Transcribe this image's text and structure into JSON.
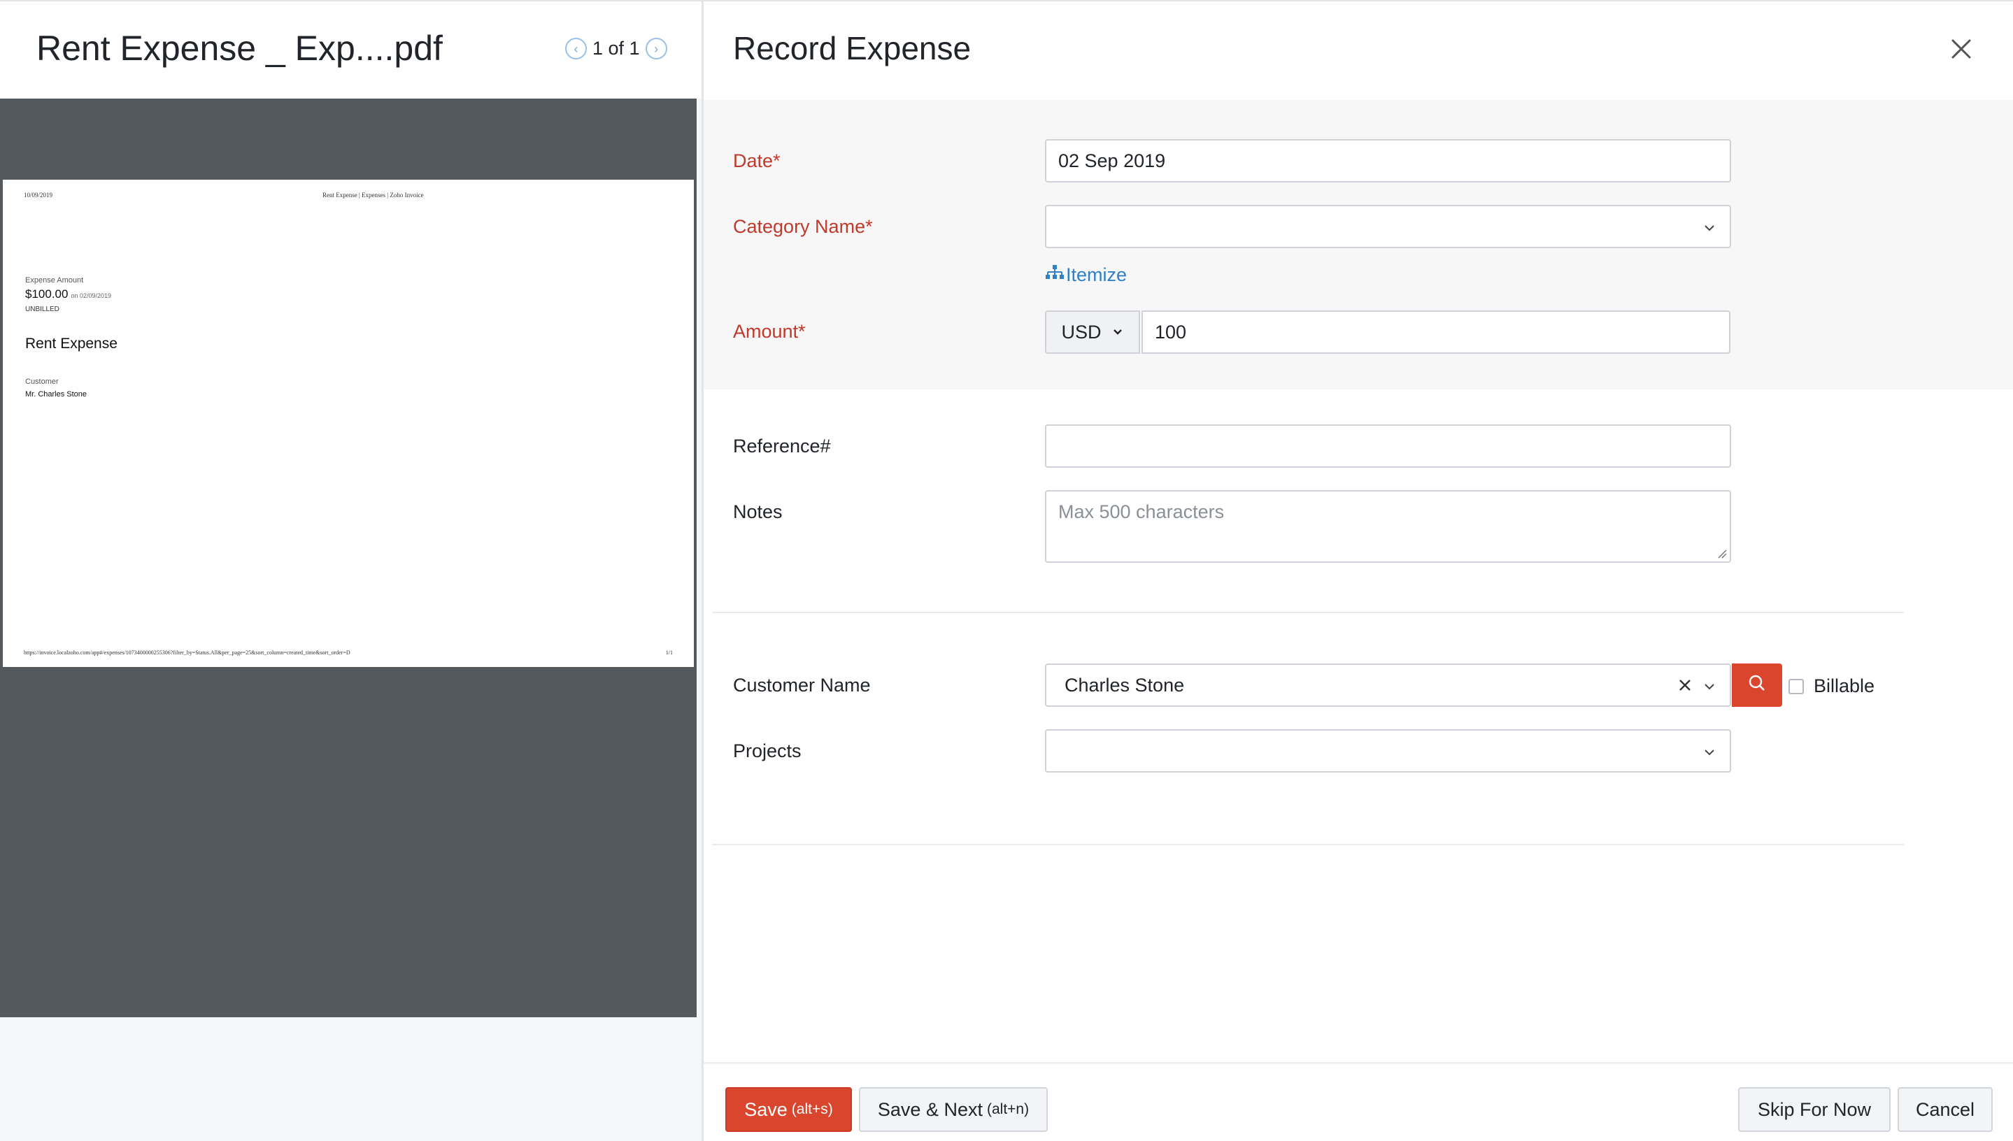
{
  "preview": {
    "file_name": "Rent Expense _ Exp....pdf",
    "pager_text": "1 of 1",
    "pdf": {
      "header_date": "10/09/2019",
      "header_title": "Rent Expense | Expenses | Zoho Invoice",
      "expense_amount_label": "Expense Amount",
      "amount": "$100.00",
      "amount_date": "on 02/09/2019",
      "status": "UNBILLED",
      "title": "Rent Expense",
      "customer_label": "Customer",
      "customer_name": "Mr. Charles Stone",
      "footer_url": "https://invoice.localzoho.com/app#/expenses/1073400000255306?filter_by=Status.All&per_page=25&sort_column=created_time&sort_order=D",
      "footer_page": "1/1"
    }
  },
  "form": {
    "title": "Record Expense",
    "date": {
      "label": "Date*",
      "value": "02 Sep 2019"
    },
    "category": {
      "label": "Category Name*",
      "value": ""
    },
    "itemize_label": "Itemize",
    "amount": {
      "label": "Amount*",
      "currency": "USD",
      "value": "100"
    },
    "reference": {
      "label": "Reference#",
      "value": ""
    },
    "notes": {
      "label": "Notes",
      "placeholder": "Max 500 characters"
    },
    "customer": {
      "label": "Customer Name",
      "value": "Charles Stone"
    },
    "billable_label": "Billable",
    "projects": {
      "label": "Projects",
      "value": ""
    }
  },
  "footer": {
    "save_label": "Save",
    "save_shortcut": "(alt+s)",
    "save_next_label": "Save & Next",
    "save_next_shortcut": "(alt+n)",
    "skip_label": "Skip For Now",
    "cancel_label": "Cancel"
  },
  "colors": {
    "accent_red": "#d9452d",
    "required_label": "#c0392b",
    "link_blue": "#2f80c8",
    "preview_bg": "#54595d"
  },
  "icons": [
    "chevron-left-icon",
    "chevron-right-icon",
    "close-icon",
    "chevron-down-icon",
    "itemize-icon",
    "clear-icon",
    "search-icon"
  ]
}
